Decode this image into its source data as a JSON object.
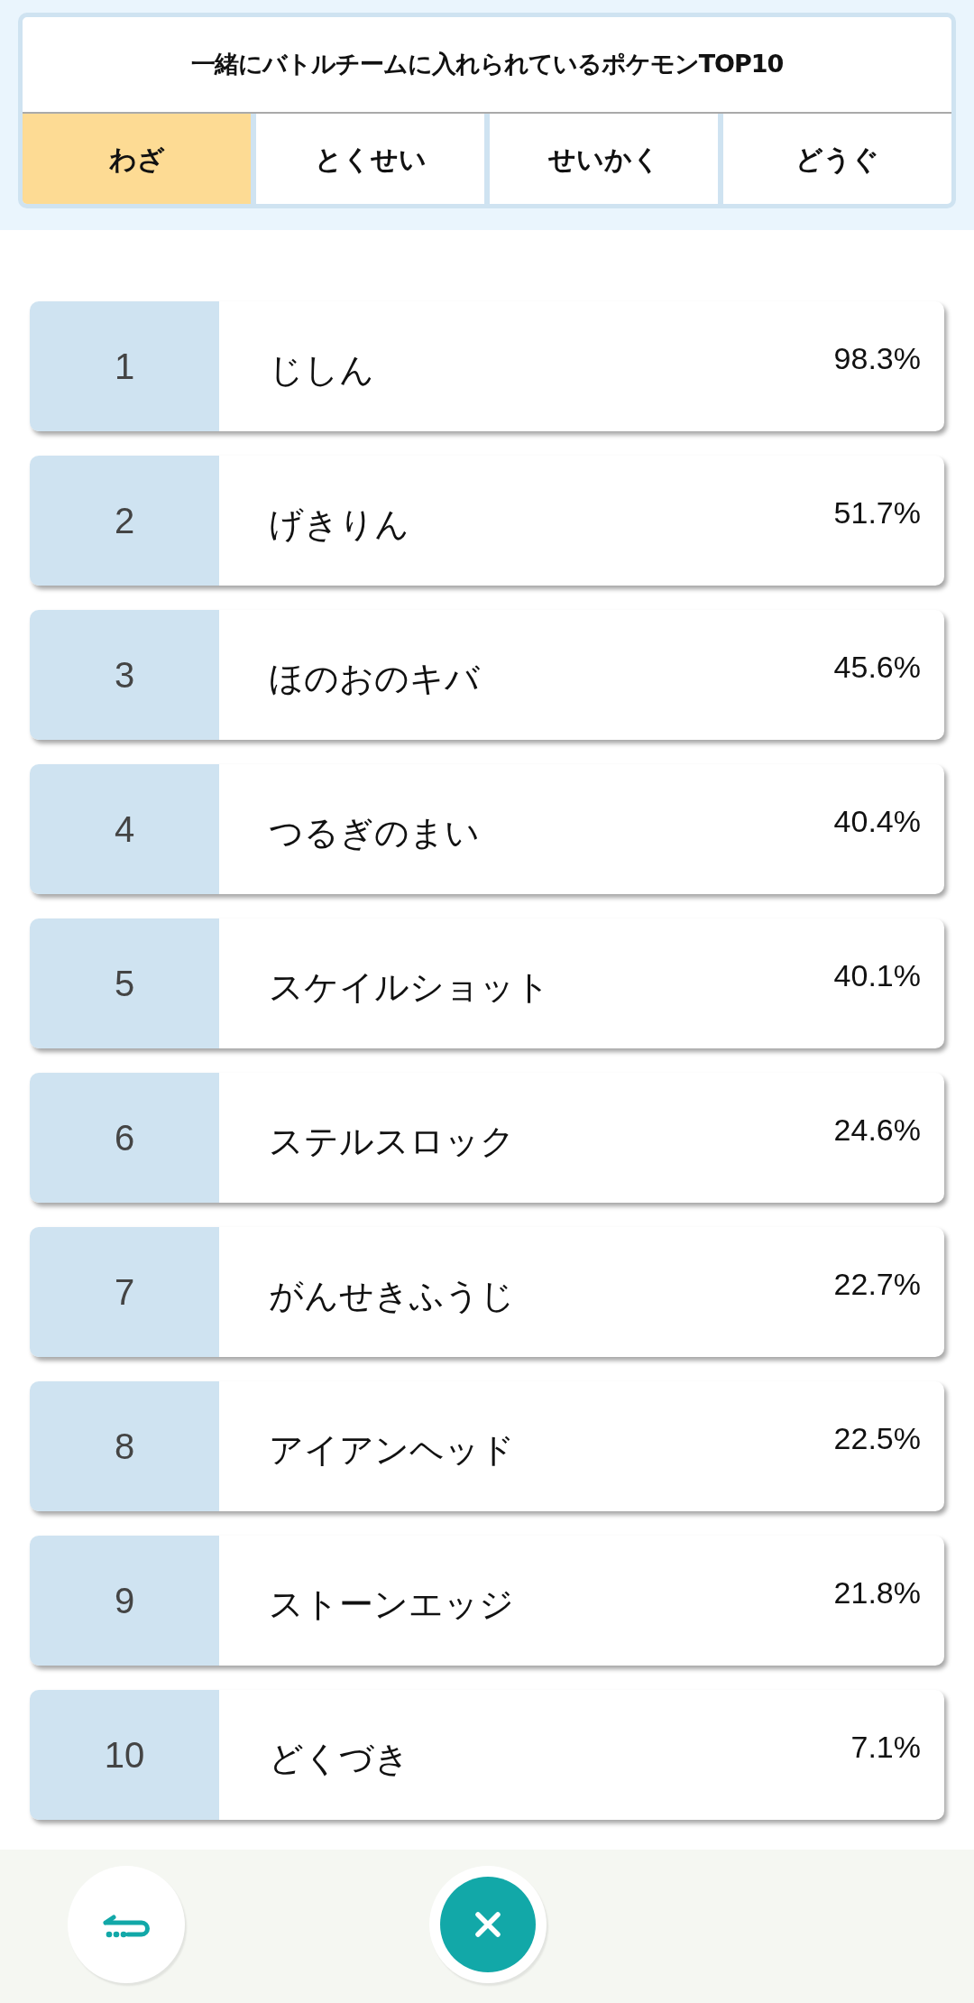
{
  "header": {
    "title": "一緒にバトルチームに入れられているポケモンTOP10"
  },
  "tabs": [
    {
      "label": "わざ",
      "selected": true
    },
    {
      "label": "とくせい",
      "selected": false
    },
    {
      "label": "せいかく",
      "selected": false
    },
    {
      "label": "どうぐ",
      "selected": false
    }
  ],
  "ranking": [
    {
      "rank": "1",
      "name": "じしん",
      "percent": "98.3%"
    },
    {
      "rank": "2",
      "name": "げきりん",
      "percent": "51.7%"
    },
    {
      "rank": "3",
      "name": "ほのおのキバ",
      "percent": "45.6%"
    },
    {
      "rank": "4",
      "name": "つるぎのまい",
      "percent": "40.4%"
    },
    {
      "rank": "5",
      "name": "スケイルショット",
      "percent": "40.1%"
    },
    {
      "rank": "6",
      "name": "ステルスロック",
      "percent": "24.6%"
    },
    {
      "rank": "7",
      "name": "がんせきふうじ",
      "percent": "22.7%"
    },
    {
      "rank": "8",
      "name": "アイアンヘッド",
      "percent": "22.5%"
    },
    {
      "rank": "9",
      "name": "ストーンエッジ",
      "percent": "21.8%"
    },
    {
      "rank": "10",
      "name": "どくづき",
      "percent": "7.1%"
    }
  ]
}
